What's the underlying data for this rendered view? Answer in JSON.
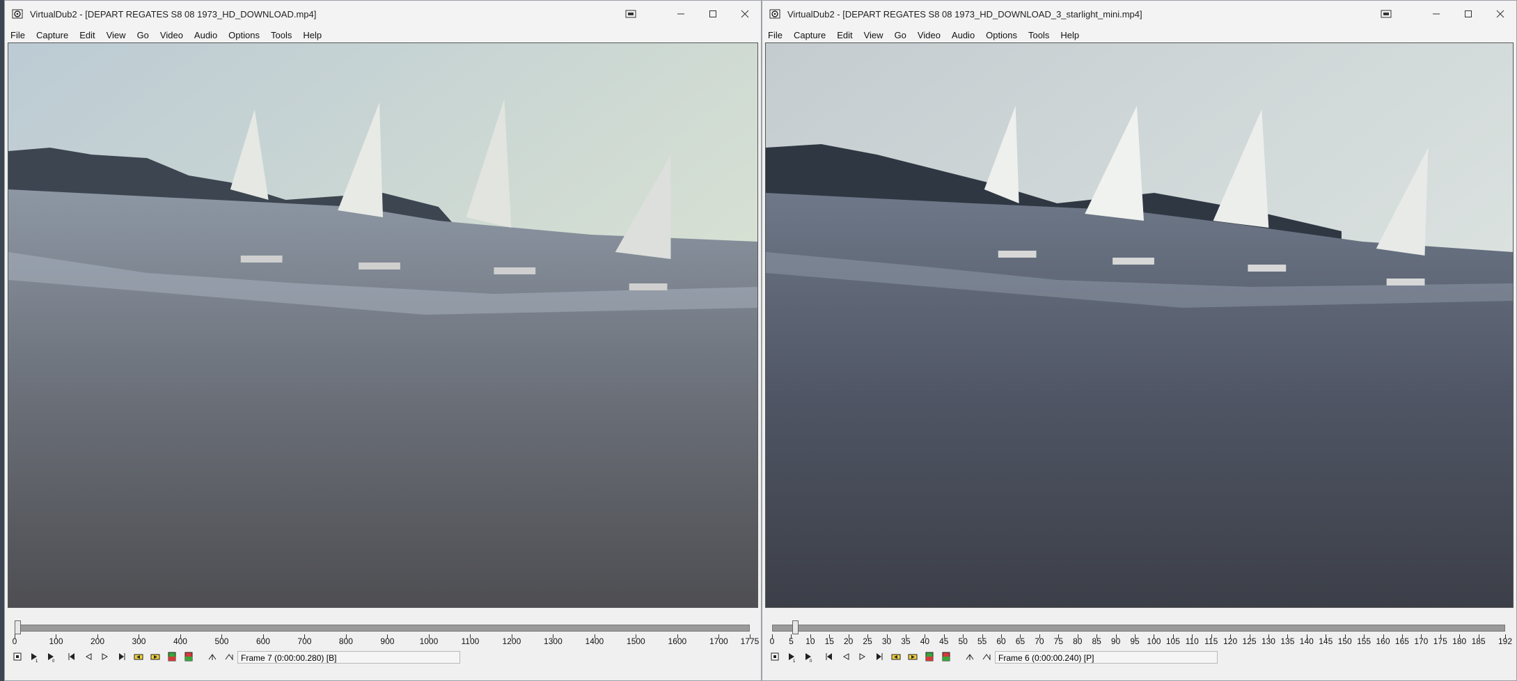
{
  "windows": [
    {
      "app": "VirtualDub2",
      "title": "VirtualDub2  - [DEPART REGATES S8 08 1973_HD_DOWNLOAD.mp4]",
      "menu": [
        "File",
        "Capture",
        "Edit",
        "View",
        "Go",
        "Video",
        "Audio",
        "Options",
        "Tools",
        "Help"
      ],
      "timeline": {
        "max": 1775,
        "position": 7,
        "ticks": [
          "0",
          "100",
          "200",
          "300",
          "400",
          "500",
          "600",
          "700",
          "800",
          "900",
          "1000",
          "1100",
          "1200",
          "1300",
          "1400",
          "1500",
          "1600",
          "1700",
          "1775"
        ]
      },
      "status": "Frame 7 (0:00:00.280) [B]"
    },
    {
      "app": "VirtualDub2",
      "title": "VirtualDub2  - [DEPART REGATES S8 08 1973_HD_DOWNLOAD_3_starlight_mini.mp4]",
      "menu": [
        "File",
        "Capture",
        "Edit",
        "View",
        "Go",
        "Video",
        "Audio",
        "Options",
        "Tools",
        "Help"
      ],
      "timeline": {
        "max": 192,
        "position": 6,
        "ticks": [
          "0",
          "5",
          "10",
          "15",
          "20",
          "25",
          "30",
          "35",
          "40",
          "45",
          "50",
          "55",
          "60",
          "65",
          "70",
          "75",
          "80",
          "85",
          "90",
          "95",
          "100",
          "105",
          "110",
          "115",
          "120",
          "125",
          "130",
          "135",
          "140",
          "145",
          "150",
          "155",
          "160",
          "165",
          "170",
          "175",
          "180",
          "185",
          "192"
        ]
      },
      "status": "Frame 6 (0:00:00.240) [P]"
    }
  ],
  "toolbar_icons": [
    "stop-icon",
    "play-input-icon",
    "play-output-icon",
    "start-icon",
    "prev-frame-icon",
    "next-frame-icon",
    "end-icon",
    "prev-key-icon",
    "next-key-icon",
    "scene-back-icon",
    "scene-fwd-icon",
    "mark-in-icon",
    "mark-out-icon"
  ],
  "colors": {
    "title_bg": "#f3f3f3",
    "window_bg": "#f0f0f0",
    "trackbar": "#9a9a9a"
  }
}
